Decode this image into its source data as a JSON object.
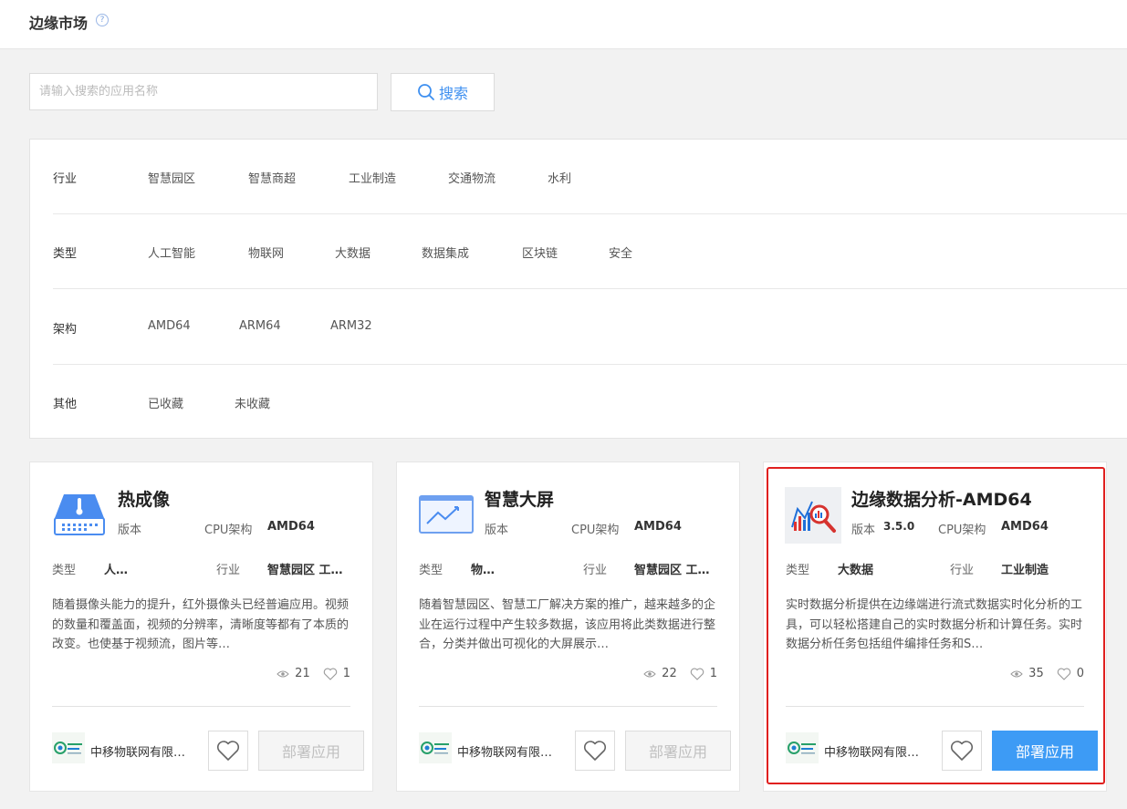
{
  "header": {
    "title": "边缘市场",
    "help_icon": "question-circle-icon",
    "help_glyph": "?"
  },
  "search": {
    "placeholder": "请输入搜索的应用名称",
    "value": "",
    "button_label": "搜索"
  },
  "filters": [
    {
      "label": "行业",
      "options": [
        "智慧园区",
        "智慧商超",
        "工业制造",
        "交通物流",
        "水利"
      ]
    },
    {
      "label": "类型",
      "options": [
        "人工智能",
        "物联网",
        "大数据",
        "数据集成",
        "区块链",
        "安全"
      ]
    },
    {
      "label": "架构",
      "options": [
        "AMD64",
        "ARM64",
        "ARM32"
      ]
    },
    {
      "label": "其他",
      "options": [
        "已收藏",
        "未收藏"
      ]
    }
  ],
  "cards": [
    {
      "name": "热成像",
      "icon": "thermal-imaging-icon",
      "version_label": "版本",
      "version": "",
      "cpu_label": "CPU架构",
      "cpu": "AMD64",
      "type_label": "类型",
      "type": "人…",
      "industry_label": "行业",
      "industry": "智慧园区 工…",
      "description": "随着摄像头能力的提升，红外摄像头已经普遍应用。视频的数量和覆盖面，视频的分辨率，清晰度等都有了本质的改变。也使基于视频流，图片等…",
      "views": "21",
      "likes": "1",
      "company": "中移物联网有限…",
      "deploy_label": "部署应用",
      "deploy_enabled": false
    },
    {
      "name": "智慧大屏",
      "icon": "dashboard-screen-icon",
      "version_label": "版本",
      "version": "",
      "cpu_label": "CPU架构",
      "cpu": "AMD64",
      "type_label": "类型",
      "type": "物…",
      "industry_label": "行业",
      "industry": "智慧园区 工…",
      "description": "随着智慧园区、智慧工厂解决方案的推广，越来越多的企业在运行过程中产生较多数据，该应用将此类数据进行整合，分类并做出可视化的大屏展示…",
      "views": "22",
      "likes": "1",
      "company": "中移物联网有限…",
      "deploy_label": "部署应用",
      "deploy_enabled": false
    },
    {
      "name": "边缘数据分析-AMD64",
      "icon": "data-analysis-icon",
      "version_label": "版本",
      "version": "3.5.0",
      "cpu_label": "CPU架构",
      "cpu": "AMD64",
      "type_label": "类型",
      "type": "大数据",
      "industry_label": "行业",
      "industry": "工业制造",
      "description": "实时数据分析提供在边缘端进行流式数据实时化分析的工具，可以轻松搭建自己的实时数据分析和计算任务。实时数据分析任务包括组件编排任务和S…",
      "views": "35",
      "likes": "0",
      "company": "中移物联网有限…",
      "deploy_label": "部署应用",
      "deploy_enabled": true
    }
  ],
  "colors": {
    "accent": "#3d9bf5",
    "highlight_border": "#e0201f",
    "icon_blue": "#4a8cf0"
  }
}
